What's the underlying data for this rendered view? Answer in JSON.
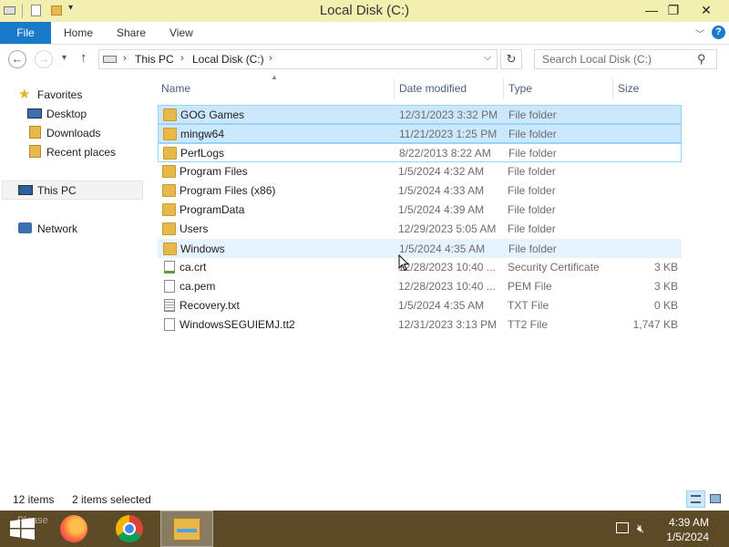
{
  "window": {
    "title": "Local Disk (C:)",
    "controls": {
      "minimize": "—",
      "maximize": "❐",
      "close": "✕"
    }
  },
  "ribbon": {
    "tabs": [
      "File",
      "Home",
      "Share",
      "View"
    ],
    "help": "?"
  },
  "address": {
    "crumbs": [
      "This PC",
      "Local Disk (C:)"
    ],
    "search_placeholder": "Search Local Disk (C:)"
  },
  "nav": {
    "favorites": "Favorites",
    "favorites_items": [
      "Desktop",
      "Downloads",
      "Recent places"
    ],
    "this_pc": "This PC",
    "network": "Network"
  },
  "columns": {
    "name": "Name",
    "date": "Date modified",
    "type": "Type",
    "size": "Size"
  },
  "files": [
    {
      "name": "GOG Games",
      "date": "12/31/2023 3:32 PM",
      "type": "File folder",
      "size": "",
      "icon": "folder-icon",
      "state": "selected"
    },
    {
      "name": "mingw64",
      "date": "11/21/2023 1:25 PM",
      "type": "File folder",
      "size": "",
      "icon": "folder-icon",
      "state": "selected"
    },
    {
      "name": "PerfLogs",
      "date": "8/22/2013 8:22 AM",
      "type": "File folder",
      "size": "",
      "icon": "folder-icon",
      "state": "focused"
    },
    {
      "name": "Program Files",
      "date": "1/5/2024 4:32 AM",
      "type": "File folder",
      "size": "",
      "icon": "folder-icon",
      "state": ""
    },
    {
      "name": "Program Files (x86)",
      "date": "1/5/2024 4:33 AM",
      "type": "File folder",
      "size": "",
      "icon": "folder-icon",
      "state": ""
    },
    {
      "name": "ProgramData",
      "date": "1/5/2024 4:39 AM",
      "type": "File folder",
      "size": "",
      "icon": "folder-icon",
      "state": ""
    },
    {
      "name": "Users",
      "date": "12/29/2023 5:05 AM",
      "type": "File folder",
      "size": "",
      "icon": "folder-icon",
      "state": ""
    },
    {
      "name": "Windows",
      "date": "1/5/2024 4:35 AM",
      "type": "File folder",
      "size": "",
      "icon": "folder-icon",
      "state": "hover"
    },
    {
      "name": "ca.crt",
      "date": "12/28/2023 10:40 ...",
      "type": "Security Certificate",
      "size": "3 KB",
      "icon": "certificate-icon",
      "state": ""
    },
    {
      "name": "ca.pem",
      "date": "12/28/2023 10:40 ...",
      "type": "PEM File",
      "size": "3 KB",
      "icon": "file-icon",
      "state": ""
    },
    {
      "name": "Recovery.txt",
      "date": "1/5/2024 4:35 AM",
      "type": "TXT File",
      "size": "0 KB",
      "icon": "text-file-icon",
      "state": ""
    },
    {
      "name": "WindowsSEGUIEMJ.tt2",
      "date": "12/31/2023 3:13 PM",
      "type": "TT2 File",
      "size": "1,747 KB",
      "icon": "file-icon",
      "state": ""
    }
  ],
  "status": {
    "count": "12 items",
    "selected": "2 items selected"
  },
  "taskbar": {
    "watermark": "Please",
    "time": "4:39 AM",
    "date": "1/5/2024"
  },
  "colors": {
    "titlebar": "#f3efb0",
    "file_tab": "#1979ca",
    "selection": "#cce8ff",
    "selection_border": "#99d1ff",
    "taskbar": "#5c4a26",
    "folder": "#e8b94a"
  }
}
